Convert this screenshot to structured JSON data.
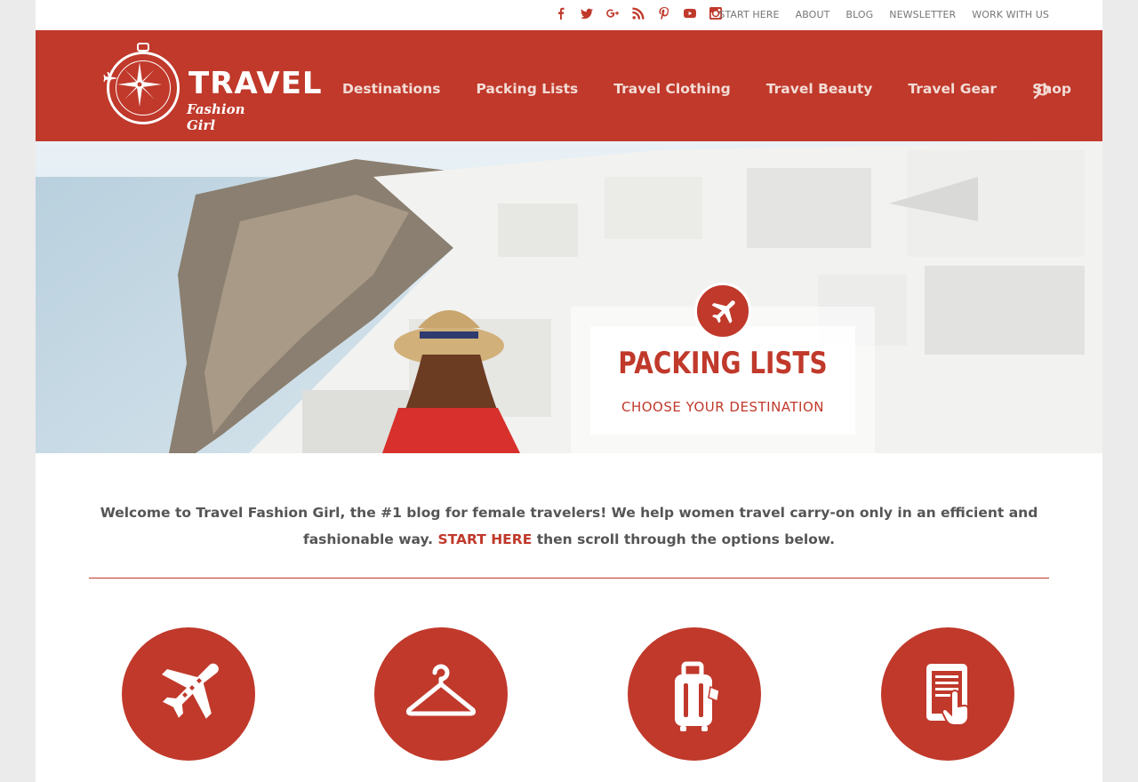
{
  "colors": {
    "brand": "#c0392b",
    "text": "#555555",
    "toplink": "#777777",
    "nav_text": "#f3dcd6"
  },
  "topbar": {
    "social_icons": [
      "facebook-icon",
      "twitter-icon",
      "google-plus-icon",
      "rss-icon",
      "pinterest-icon",
      "youtube-icon",
      "instagram-icon"
    ],
    "links": [
      "START HERE",
      "ABOUT",
      "BLOG",
      "NEWSLETTER",
      "WORK WITH US"
    ]
  },
  "header": {
    "logo_word1": "TRAVEL",
    "logo_word2": "Fashion Girl",
    "nav": [
      "Destinations",
      "Packing Lists",
      "Travel Clothing",
      "Travel Beauty",
      "Travel Gear",
      "Shop"
    ],
    "search_icon": "search-icon"
  },
  "hero": {
    "title": "PACKING LISTS",
    "subtitle": "CHOOSE YOUR DESTINATION",
    "badge_icon": "airplane-icon"
  },
  "welcome": {
    "text_before": "Welcome to Travel Fashion Girl, the #1 blog for female travelers! We help women travel carry-on only in an efficient and fashionable way.",
    "link_label": "START HERE",
    "text_after": "then scroll through the options below."
  },
  "categories": [
    {
      "icon": "airplane-icon"
    },
    {
      "icon": "hanger-icon"
    },
    {
      "icon": "luggage-icon"
    },
    {
      "icon": "tablet-touch-icon"
    }
  ]
}
